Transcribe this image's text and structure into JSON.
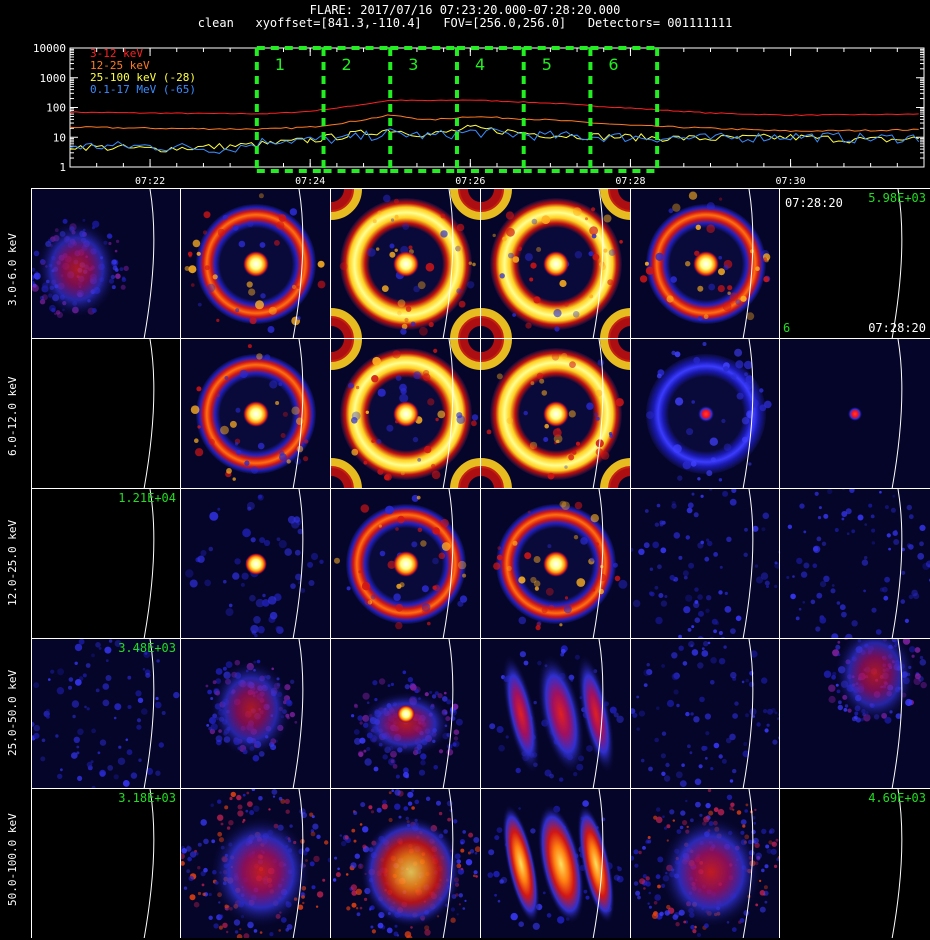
{
  "header": {
    "line1": "FLARE: 2017/07/16 07:23:20.000-07:28:20.000",
    "line2": "clean   xyoffset=[841.3,-110.4]   FOV=[256.0,256.0]   Detectors= 001111111"
  },
  "lightcurve": {
    "yticks": [
      "10000",
      "1000",
      "100",
      "10",
      "1"
    ],
    "xticks": [
      "07:22",
      "07:24",
      "07:26",
      "07:28",
      "07:30"
    ],
    "legend": [
      {
        "label": "3-12 keV",
        "color": "#ff2020"
      },
      {
        "label": "12-25 keV",
        "color": "#ff7a20"
      },
      {
        "label": "25-100 keV (-28)",
        "color": "#ffff40"
      },
      {
        "label": "0.1-17 MeV (-65)",
        "color": "#3a8cff"
      }
    ],
    "intervals": [
      "1",
      "2",
      "3",
      "4",
      "5",
      "6"
    ],
    "interval_color": "#22ee22"
  },
  "chart_data": {
    "type": "line",
    "title": "",
    "xlabel": "",
    "ylabel": "",
    "ylim": [
      1,
      10000
    ],
    "yscale": "log",
    "xlim": [
      "07:21:00",
      "07:31:40"
    ],
    "series": [
      {
        "name": "3-12 keV",
        "x": [
          "07:21:00",
          "07:22:00",
          "07:23:00",
          "07:23:30",
          "07:24:00",
          "07:24:30",
          "07:25:00",
          "07:25:30",
          "07:26:00",
          "07:27:00",
          "07:28:00",
          "07:29:00",
          "07:30:00",
          "07:31:00",
          "07:31:40"
        ],
        "values": [
          70,
          65,
          62,
          62,
          75,
          110,
          175,
          170,
          180,
          140,
          95,
          65,
          55,
          58,
          60
        ]
      },
      {
        "name": "12-25 keV",
        "x": [
          "07:21:00",
          "07:22:00",
          "07:23:00",
          "07:23:30",
          "07:24:00",
          "07:24:30",
          "07:25:00",
          "07:25:30",
          "07:26:00",
          "07:27:00",
          "07:28:00",
          "07:29:00",
          "07:30:00",
          "07:31:00",
          "07:31:40"
        ],
        "values": [
          22,
          20,
          19,
          19,
          22,
          33,
          55,
          38,
          50,
          38,
          25,
          20,
          16,
          17,
          18
        ]
      },
      {
        "name": "25-100 keV (-28)",
        "x": [
          "07:21:00",
          "07:22:00",
          "07:23:00",
          "07:23:30",
          "07:24:00",
          "07:24:30",
          "07:25:00",
          "07:25:30",
          "07:26:00",
          "07:27:00",
          "07:28:00",
          "07:29:00",
          "07:30:00",
          "07:31:00",
          "07:31:40"
        ],
        "values": [
          5,
          4,
          5,
          6,
          8,
          12,
          18,
          12,
          20,
          12,
          10,
          9,
          10,
          8,
          9
        ]
      },
      {
        "name": "0.1-17 MeV (-65)",
        "x": [
          "07:21:00",
          "07:22:00",
          "07:23:00",
          "07:23:30",
          "07:24:00",
          "07:24:30",
          "07:25:00",
          "07:25:30",
          "07:26:00",
          "07:27:00",
          "07:28:00",
          "07:29:00",
          "07:30:00",
          "07:31:00",
          "07:31:40"
        ],
        "values": [
          5,
          5,
          4,
          8,
          8,
          9,
          14,
          11,
          15,
          11,
          10,
          9,
          11,
          9,
          10
        ]
      }
    ],
    "intervals": [
      {
        "label": "1",
        "start": "07:23:20",
        "end": "07:24:10"
      },
      {
        "label": "2",
        "start": "07:24:10",
        "end": "07:25:00"
      },
      {
        "label": "3",
        "start": "07:25:00",
        "end": "07:25:50"
      },
      {
        "label": "4",
        "start": "07:25:50",
        "end": "07:26:40"
      },
      {
        "label": "5",
        "start": "07:26:40",
        "end": "07:27:30"
      },
      {
        "label": "6",
        "start": "07:27:30",
        "end": "07:28:20"
      }
    ]
  },
  "image_grid": {
    "rows": [
      {
        "label": "3.0-6.0 keV",
        "cells": [
          {
            "kind": "blob_weak"
          },
          {
            "kind": "ring_mid"
          },
          {
            "kind": "ring_strong"
          },
          {
            "kind": "ring_strong"
          },
          {
            "kind": "ring_mid"
          },
          {
            "kind": "empty",
            "value": "5.98E+03",
            "time_top": "07:28:20",
            "time_bottom": "07:28:20",
            "corner": "6"
          }
        ]
      },
      {
        "label": "6.0-12.0 keV",
        "cells": [
          {
            "kind": "empty"
          },
          {
            "kind": "ring_mid"
          },
          {
            "kind": "ring_strong"
          },
          {
            "kind": "ring_strong"
          },
          {
            "kind": "ring_weak"
          },
          {
            "kind": "dot_weak"
          }
        ]
      },
      {
        "label": "12.0-25.0 keV",
        "cells": [
          {
            "kind": "empty",
            "value": "1.21E+04"
          },
          {
            "kind": "dot_speckle"
          },
          {
            "kind": "ring_mid"
          },
          {
            "kind": "ring_mid"
          },
          {
            "kind": "speckle"
          },
          {
            "kind": "speckle"
          }
        ]
      },
      {
        "label": "25.0-50.0 keV",
        "cells": [
          {
            "kind": "speckle",
            "value": "3.48E+03"
          },
          {
            "kind": "blob_speckle"
          },
          {
            "kind": "dot_blob"
          },
          {
            "kind": "stripes"
          },
          {
            "kind": "speckle"
          },
          {
            "kind": "blob_speckle_right"
          }
        ]
      },
      {
        "label": "50.0-100.0 keV",
        "cells": [
          {
            "kind": "empty",
            "value": "3.18E+03"
          },
          {
            "kind": "diffuse"
          },
          {
            "kind": "diffuse_strong"
          },
          {
            "kind": "stripes_strong"
          },
          {
            "kind": "diffuse"
          },
          {
            "kind": "empty",
            "value": "4.69E+03"
          }
        ]
      }
    ]
  }
}
